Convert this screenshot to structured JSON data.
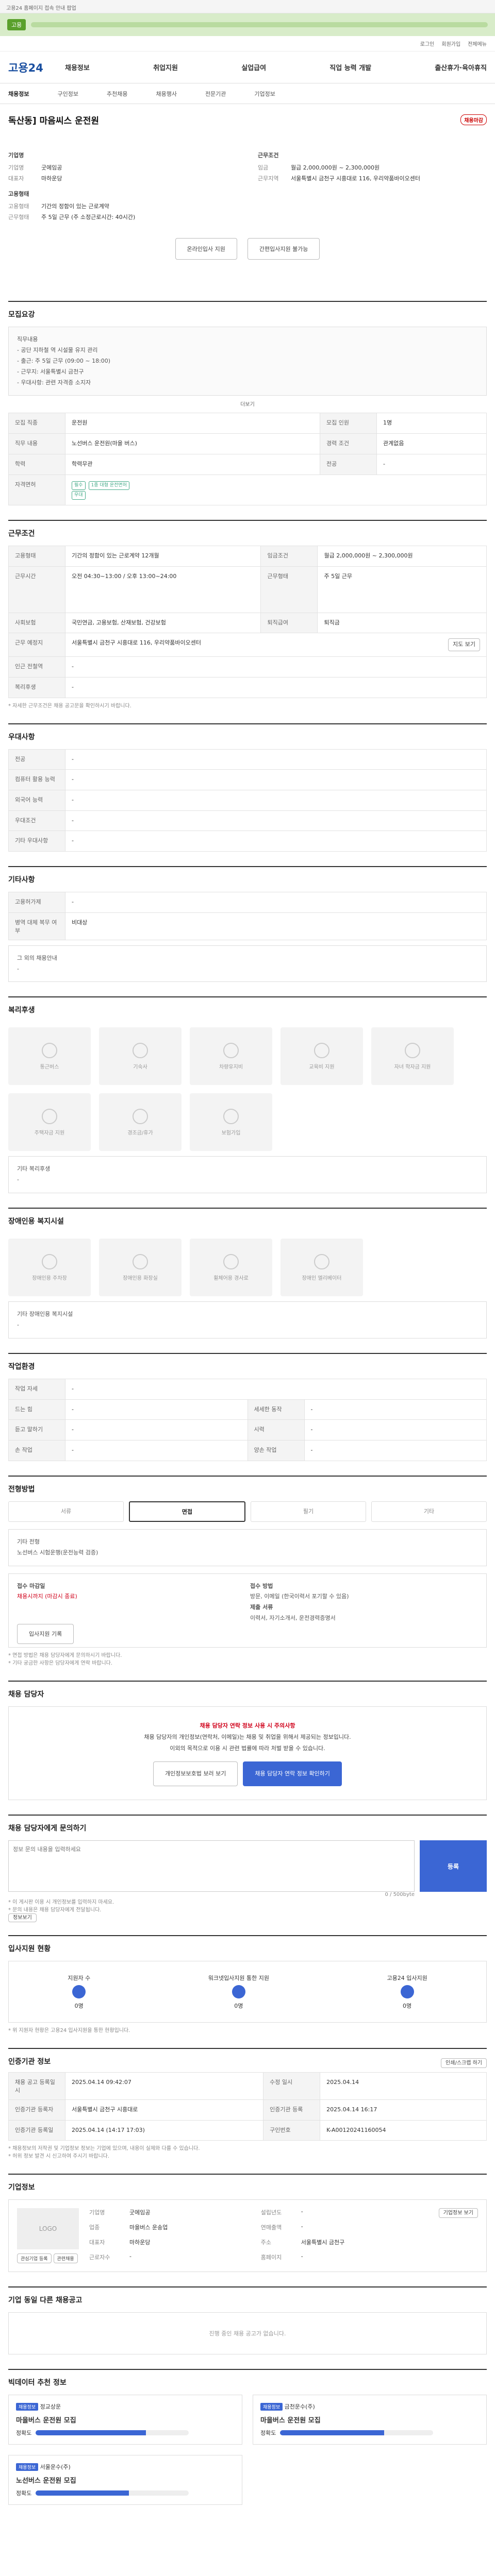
{
  "topbar": {
    "notice": "고용24 홈페이지 접속 안내 팝업"
  },
  "greenbar": {
    "pill": "고용"
  },
  "util": [
    "로그인",
    "회원가입",
    "전체메뉴"
  ],
  "gnb": {
    "logo": "고용24",
    "menu": [
      "채용정보",
      "취업지원",
      "실업급여",
      "직업 능력 개발",
      "출산휴가·육아휴직"
    ]
  },
  "sub": [
    "채용정보",
    "구인정보",
    "추천채용",
    "채용행사",
    "전문기관",
    "기업정보"
  ],
  "job": {
    "title": "독산동] 마음씨스 운전원",
    "badge": "채용마감",
    "company_label": "기업명",
    "company": "굿에임공",
    "rep_label": "대표자",
    "rep": "마하운당",
    "cond_label": "근무조건",
    "wage_label": "임금",
    "wage": "월급 2,000,000원 ~ 2,300,000원",
    "place_label": "근무지역",
    "place": "서울특별시 금천구 시흥대로 116, 우리약품바이오센터",
    "employ_label": "고용형태",
    "employ": "기간의 정함이 있는 근로계약",
    "time_label": "근무형태",
    "time": "주 5일 근무 (주 소정근로시간: 40시간)",
    "btn_apply": "온라인입사 지원",
    "btn_scrap": "간편입사지원 불가능"
  },
  "sec1": {
    "title": "모집요강",
    "box": [
      "직무내용",
      "- 공단 지하철 역 시설물 유지 관리",
      "- 출근: 주 5일 근무 (09:00 ~ 18:00)",
      "- 근무지: 서울특별시 금천구",
      "- 우대사항: 관련 자격증 소지자"
    ],
    "more": "더보기",
    "rows": [
      [
        "모집 직종",
        "운전원",
        "모집 인원",
        "1명"
      ],
      [
        "직무 내용",
        "노선버스 운전원(마을 버스)",
        "경력 조건",
        "관계없음"
      ],
      [
        "학력",
        "학력무관",
        "전공",
        "-"
      ],
      [
        "자격면허",
        "1종 대형 운전면허",
        "",
        ""
      ]
    ],
    "tag1": "필수",
    "tag2": "우대"
  },
  "sec2": {
    "title": "근무조건",
    "rows": [
      [
        "고용형태",
        "기간의 정함이 있는 근로계약 12개월",
        "임금조건",
        "월급 2,000,000원 ~ 2,300,000원"
      ],
      [
        "근무시간",
        "오전 04:30~13:00 / 오후 13:00~24:00",
        "근무형태",
        "주 5일 근무"
      ],
      [
        "사회보험",
        "국민연금, 고용보험, 산재보험, 건강보험",
        "퇴직급여",
        "퇴직금"
      ],
      [
        "근무 예정지",
        "서울특별시 금천구 시흥대로 116, 우리약품바이오센터",
        "",
        ""
      ],
      [
        "인근 전철역",
        "-",
        "",
        ""
      ],
      [
        "복리후생",
        "-",
        "",
        ""
      ]
    ],
    "note": "* 자세한 근무조건은 채용 공고문을 확인하시기 바랍니다.",
    "map_btn": "지도 보기"
  },
  "sec3": {
    "title": "우대사항",
    "rows": [
      [
        "전공",
        "-"
      ],
      [
        "컴퓨터 활용 능력",
        "-"
      ],
      [
        "외국어 능력",
        "-"
      ],
      [
        "우대조건",
        "-"
      ],
      [
        "기타 우대사항",
        "-"
      ]
    ]
  },
  "sec4": {
    "title": "기타사항",
    "rows": [
      [
        "고용허가제",
        "-"
      ],
      [
        "병역 대체 복무 여부",
        "비대상"
      ]
    ],
    "extra_label": "그 외의 채용안내",
    "extra": "-"
  },
  "sec5": {
    "title": "복리후생",
    "items": [
      "통근버스",
      "기숙사",
      "차량유지비",
      "교육비 지원",
      "자녀 학자금 지원",
      "주택자금 지원",
      "경조금/휴가",
      "보험가입"
    ],
    "etc_label": "기타 복리후생",
    "etc": "-"
  },
  "sec6": {
    "title": "장애인용 복지시설",
    "items": [
      "장애인용 주차장",
      "장애인용 화장실",
      "휠체어용 경사로",
      "장애인 엘리베이터"
    ],
    "etc_label": "기타 장애인용 복지시설",
    "etc": "-"
  },
  "sec7": {
    "title": "작업환경",
    "rows": [
      [
        "작업 자세",
        "-",
        "",
        ""
      ],
      [
        "드는 힘",
        "-",
        "세세한 동작",
        "-"
      ],
      [
        "듣고 말하기",
        "-",
        "시력",
        "-"
      ],
      [
        "손 작업",
        "-",
        "양손 작업",
        "-"
      ]
    ]
  },
  "sec8": {
    "title": "전형방법",
    "tabs": [
      "서류",
      "면접",
      "필기",
      "기타"
    ],
    "active": 1,
    "method_label": "기타 전형",
    "method": "노선버스 시험운행(운전능력 검증)",
    "doc_label": "접수 마감일",
    "doc": "채용시까지 (마감시 종료)",
    "how_label": "접수 방법",
    "how": "방문, 이메일 (한국이력서 포기할 수 있음)",
    "apply_label": "제출 서류",
    "apply": "이력서, 자기소개서, 운전경력증명서",
    "btn": "입사지원 기록",
    "notes": [
      "* 면접 방법은 채용 담당자에게 문의하시기 바랍니다.",
      "* 기타 궁금한 사항은 담당자에게 연락 바랍니다."
    ]
  },
  "sec9": {
    "title": "채용 담당자",
    "warn1": "채용 담당자 연락 정보 사용 시 주의사항",
    "warn2": "채용 담당자의 개인정보(연락처, 이메일)는 채용 및 취업을 위해서 제공되는 정보입니다.",
    "warn3": "이외의 목적으로 이용 시 관련 법률에 따라 처벌 받을 수 있습니다.",
    "b1": "개인정보보호법 보러 보기",
    "b2": "채용 담당자 연락 정보 확인하기"
  },
  "sec10": {
    "title": "채용 담당자에게 문의하기",
    "placeholder": "정보 문의 내용을 입력하세요",
    "submit": "등록",
    "count": "0 / 500byte",
    "notes": [
      "* 이 게시판 이용 시 개인정보를 입력하지 마세요.",
      "* 문의 내용은 채용 담당자에게 전달됩니다."
    ],
    "link": "정보보기"
  },
  "sec11": {
    "title": "입사지원 현황",
    "items": [
      [
        "지원자 수",
        "0명"
      ],
      [
        "워크넷입사지원 통한 지원",
        "0명"
      ],
      [
        "고용24 입사지원",
        "0명"
      ]
    ],
    "note": "* 위 지원자 현황은 고용24 입사지원을 통한 현황입니다."
  },
  "sec12": {
    "title": "인증기관 정보",
    "rows": [
      [
        "채용 공고 등록일시",
        "2025.04.14 09:42:07",
        "수정 일시",
        "2025.04.14"
      ],
      [
        "인증기관 등록자",
        "서울특별시 금천구 시흥대로",
        "인증기관 등록",
        "2025.04.14 16:17"
      ],
      [
        "인증기관 등록일",
        "2025.04.14 (14:17 17:03)",
        "구인번호",
        "K-A00120241160054"
      ]
    ],
    "print": "인쇄/스크랩 하기",
    "notes": [
      "* 채용정보의 저작권 및 기업정보 정보는 기업에 있으며, 내용이 실제와 다를 수 있습니다.",
      "* 허위 정보 발견 시 신고하여 주시기 바랍니다."
    ]
  },
  "sec13": {
    "title": "기업정보",
    "logo": "LOGO",
    "btn": "기업정보 보기",
    "grid": [
      [
        "기업명",
        "굿에임공"
      ],
      [
        "업종",
        "마을버스 운송업"
      ],
      [
        "대표자",
        "마하운당"
      ],
      [
        "근로자수",
        "-"
      ],
      [
        "설립년도",
        "-"
      ],
      [
        "연매출액",
        "-"
      ],
      [
        "주소",
        "서울특별시 금천구"
      ],
      [
        "홈페이지",
        "-"
      ]
    ],
    "b1": "관심기업 등록",
    "b2": "관련채용"
  },
  "sec14": {
    "title": "기업 동일 다른 채용공고",
    "empty": "진행 중인 채용 공고가 없습니다."
  },
  "sec15": {
    "title": "빅데이터 추천 정보",
    "cards": [
      {
        "badge": "채용정보",
        "comp": "정교상운",
        "title": "마을버스 운전원 모집",
        "fit": "정확도",
        "pct": 72
      },
      {
        "badge": "채용정보",
        "comp": "금천운수(주)",
        "title": "마을버스 운전원 모집",
        "fit": "정확도",
        "pct": 68
      },
      {
        "badge": "채용정보",
        "comp": "서울운수(주)",
        "title": "노선버스 운전원 모집",
        "fit": "정확도",
        "pct": 61
      }
    ]
  },
  "colors": {
    "brand": "#1a4fa0",
    "accent": "#3b66d4",
    "alert": "#d0021b"
  }
}
